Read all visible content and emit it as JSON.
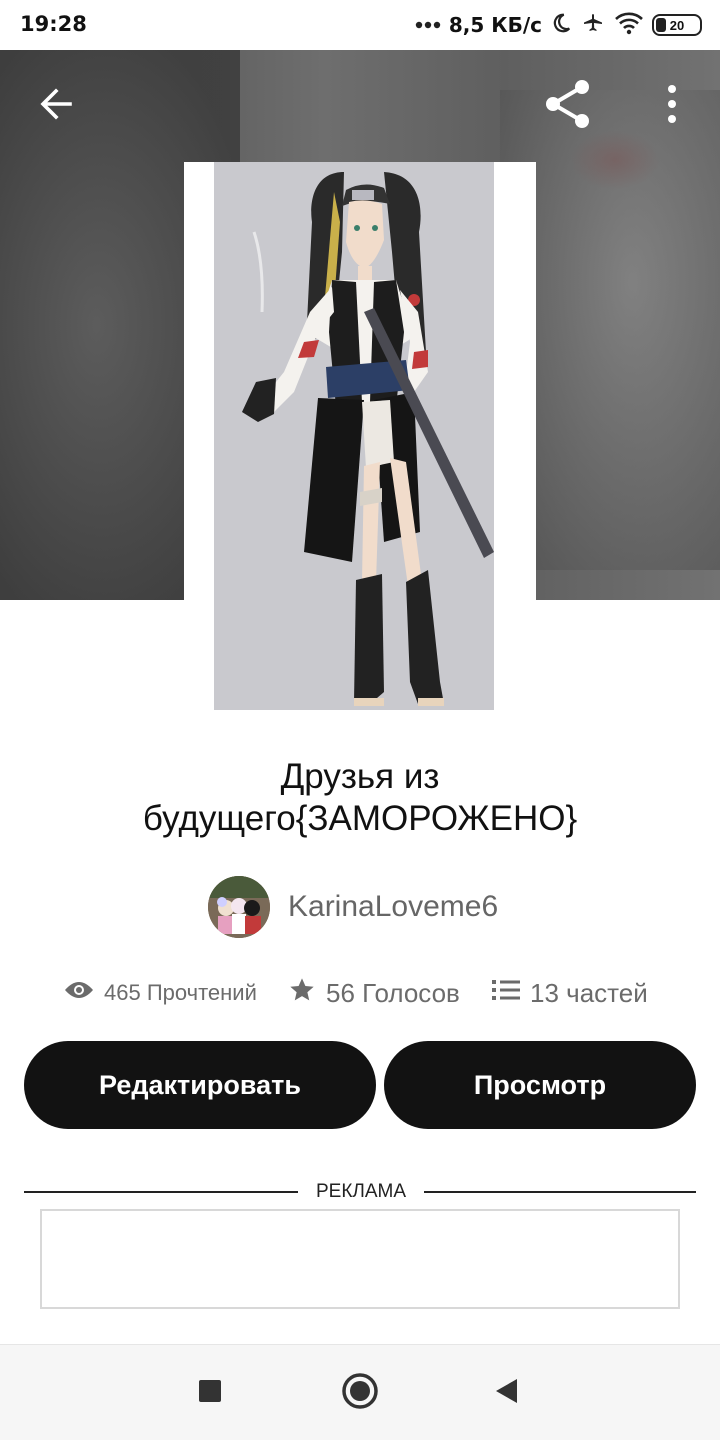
{
  "status_bar": {
    "time": "19:28",
    "network_speed": "8,5 КБ/с",
    "battery_level": "20",
    "icons": [
      "dots-icon",
      "moon-icon",
      "airplane-icon",
      "wifi-icon",
      "battery-icon"
    ]
  },
  "top_bar": {
    "back_icon": "arrow-left-icon",
    "share_icon": "share-icon",
    "more_icon": "more-vertical-icon"
  },
  "story": {
    "title": "Друзья из будущего{ЗАМОРОЖЕНО}",
    "author": "KarinaLoveme6"
  },
  "stats": {
    "reads": "465 Прочтений",
    "votes": "56 Голосов",
    "parts": "13 частей"
  },
  "actions": {
    "edit_label": "Редактировать",
    "view_label": "Просмотр"
  },
  "ad": {
    "label": "РЕКЛАМА"
  },
  "nav": {
    "recent_icon": "square-icon",
    "home_icon": "circle-icon",
    "back_icon": "triangle-back-icon"
  },
  "colors": {
    "button_bg": "#121212",
    "button_text": "#ffffff",
    "meta_text": "#6b6b6b"
  }
}
